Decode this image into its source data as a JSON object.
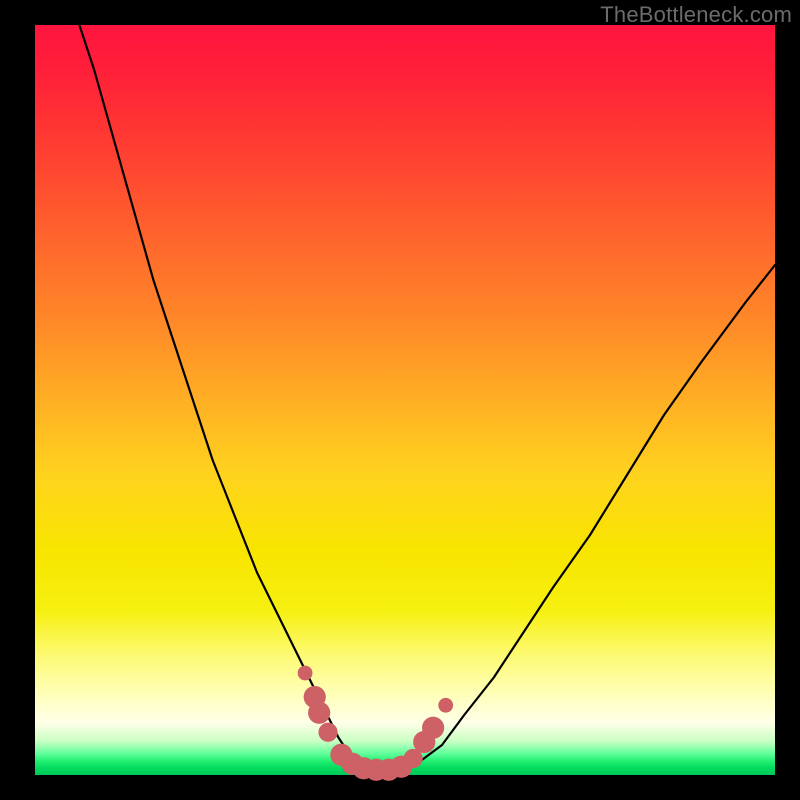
{
  "watermark": "TheBottleneck.com",
  "chart_data": {
    "type": "line",
    "title": "",
    "xlabel": "",
    "ylabel": "",
    "xlim": [
      0,
      100
    ],
    "ylim": [
      0,
      100
    ],
    "series": [
      {
        "name": "bottleneck-curve",
        "x": [
          6,
          8,
          10,
          12,
          14,
          16,
          18,
          20,
          22,
          24,
          26,
          28,
          30,
          32,
          34,
          36,
          38,
          40,
          41,
          42,
          43,
          44,
          45,
          46,
          48,
          50,
          52,
          55,
          58,
          62,
          66,
          70,
          75,
          80,
          85,
          90,
          96,
          100
        ],
        "y": [
          100,
          94,
          87,
          80,
          73,
          66,
          60,
          54,
          48,
          42,
          37,
          32,
          27,
          23,
          19,
          15,
          11,
          7,
          5,
          3.5,
          2.2,
          1.2,
          0.6,
          0.3,
          0.3,
          0.7,
          1.8,
          4,
          8,
          13,
          19,
          25,
          32,
          40,
          48,
          55,
          63,
          68
        ]
      }
    ],
    "markers": {
      "name": "highlight-points",
      "color": "#cd6166",
      "points": [
        {
          "x": 36.5,
          "y": 13.6,
          "r": 1.0
        },
        {
          "x": 37.8,
          "y": 10.4,
          "r": 1.5
        },
        {
          "x": 38.4,
          "y": 8.3,
          "r": 1.5
        },
        {
          "x": 39.6,
          "y": 5.7,
          "r": 1.3
        },
        {
          "x": 41.4,
          "y": 2.7,
          "r": 1.5
        },
        {
          "x": 42.9,
          "y": 1.5,
          "r": 1.5
        },
        {
          "x": 44.4,
          "y": 0.9,
          "r": 1.5
        },
        {
          "x": 46.1,
          "y": 0.7,
          "r": 1.5
        },
        {
          "x": 47.8,
          "y": 0.7,
          "r": 1.5
        },
        {
          "x": 49.5,
          "y": 1.1,
          "r": 1.5
        },
        {
          "x": 51.1,
          "y": 2.2,
          "r": 1.3
        },
        {
          "x": 52.6,
          "y": 4.4,
          "r": 1.5
        },
        {
          "x": 53.8,
          "y": 6.3,
          "r": 1.5
        },
        {
          "x": 55.5,
          "y": 9.3,
          "r": 1.0
        }
      ]
    }
  }
}
